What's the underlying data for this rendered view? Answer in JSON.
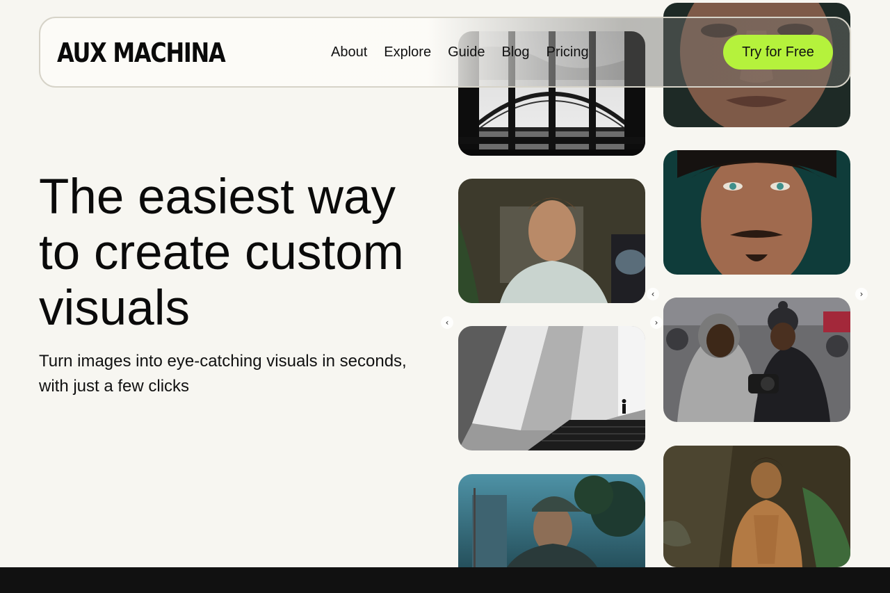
{
  "header": {
    "logo": "AUX MACHINA",
    "nav": [
      "About",
      "Explore",
      "Guide",
      "Blog",
      "Pricing"
    ],
    "cta": "Try for Free"
  },
  "hero": {
    "title": "The easiest way to create custom visuals",
    "subtitle": "Turn images into eye-catching visuals in seconds, with just a few clicks"
  },
  "colors": {
    "background": "#f7f6f1",
    "accent": "#b5f23c",
    "footer": "#111111"
  },
  "gallery": {
    "left_column": [
      "bridge-window-bw",
      "man-plant-portrait",
      "architecture-bw",
      "man-cap-street"
    ],
    "right_column": [
      "closeup-face",
      "freckled-man-portrait",
      "street-camera-pair",
      "shirtless-man-graffiti"
    ],
    "arrow_icons": [
      "chevron-left-icon",
      "chevron-right-icon"
    ]
  }
}
